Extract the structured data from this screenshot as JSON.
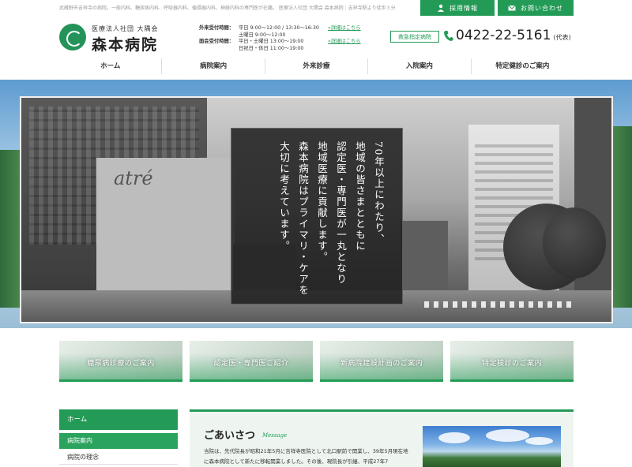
{
  "header": {
    "top_text": "武蔵野市吉祥寺の病院。一般内科、糖尿病内科、呼吸器内科、循環器内科、神経内科の専門医が在籍。 医療法人社団 大隅会 森本病院｜吉祥寺駅より徒歩３分",
    "recruit_label": "採用情報",
    "contact_label": "お問い合わせ",
    "logo_corp": "医療法人社団 大隅会",
    "logo_name": "森本病院",
    "hours": [
      {
        "label": "外来受付時間：",
        "line1": "平日 9:00～12:00 / 13:30～16:30",
        "line2": "土曜日 9:00～12:00",
        "link": "»詳細はこちら"
      },
      {
        "label": "面会受付時間：",
        "line1": "平日・土曜日 13:00～19:00",
        "line2": "日祝日・休日 11:00～19:00",
        "link": "»詳細はこちら"
      }
    ],
    "emergency_label": "救急指定病院",
    "phone_number": "0422-22-5161",
    "phone_suffix": "(代表)"
  },
  "nav": {
    "items": [
      {
        "label": "ホーム"
      },
      {
        "label": "病院案内"
      },
      {
        "label": "外来診療"
      },
      {
        "label": "入院案内"
      },
      {
        "label": "特定健診のご案内"
      }
    ]
  },
  "hero": {
    "sign_text": "atré",
    "message": "70年以上にわたり、\n地域の皆さまとともに\n認定医・専門医が一丸となり\n地域医療に貢献します。\n森本病院はプライマリ・ケアを\n大切に考えています。"
  },
  "cards": [
    {
      "label": "糖尿病診療のご案内"
    },
    {
      "label": "認定医・専門医ご紹介"
    },
    {
      "label": "新病院建設計画のご案内"
    },
    {
      "label": "特定検診のご案内"
    }
  ],
  "sidebar": {
    "home_label": "ホーム",
    "section_label": "病院案内",
    "item_label": "病院の理念"
  },
  "greeting": {
    "title": "ごあいさつ",
    "subtitle": "Message",
    "body": "当院は、先代院長が昭和21年5月に吉祥寺医院として北口駅前で開業し、39年5月現在地に森本病院として新たに移転開業しました。その後、現院長が引継、平成27年7"
  },
  "icons": {
    "recruit": "person-icon",
    "contact": "mail-icon",
    "phone": "phone-icon",
    "logo": "hospital-logo-mark"
  },
  "colors": {
    "brand_green": "#239b56"
  }
}
